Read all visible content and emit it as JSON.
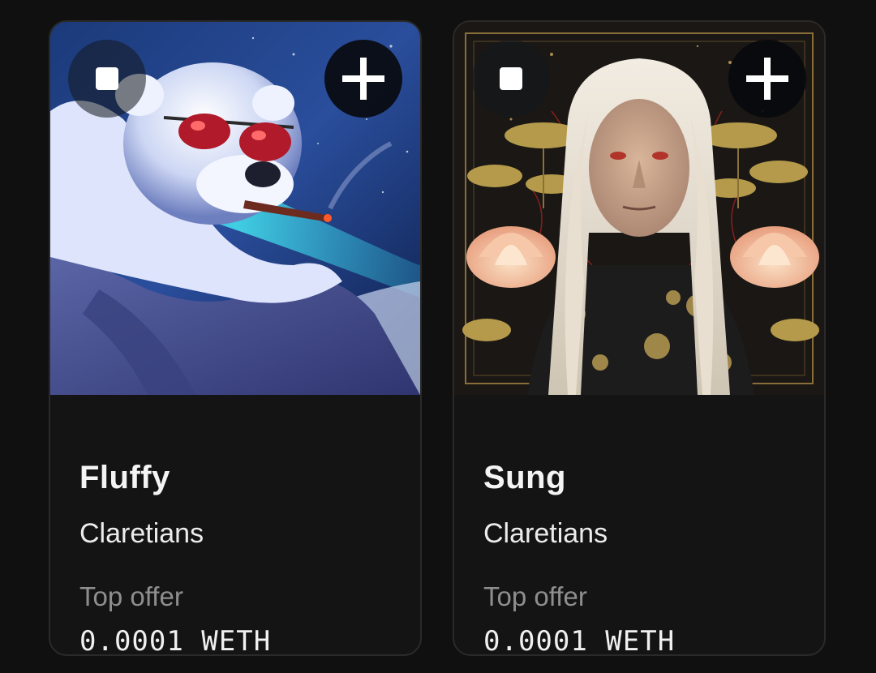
{
  "cards": [
    {
      "name": "Fluffy",
      "collection": "Claretians",
      "offer_label": "Top offer",
      "offer_value": "0.0001 WETH",
      "image": "polar-bear-with-sunglasses-and-cigar"
    },
    {
      "name": "Sung",
      "collection": "Claretians",
      "offer_label": "Top offer",
      "offer_value": "0.0001 WETH",
      "image": "elder-with-long-white-hair-and-lotus-flowers"
    }
  ],
  "icons": {
    "select": "select-square-icon",
    "add": "plus-icon"
  },
  "colors": {
    "background": "#101010",
    "card": "#141414",
    "border": "#2a2a2a",
    "muted_text": "#8e8e8e"
  }
}
